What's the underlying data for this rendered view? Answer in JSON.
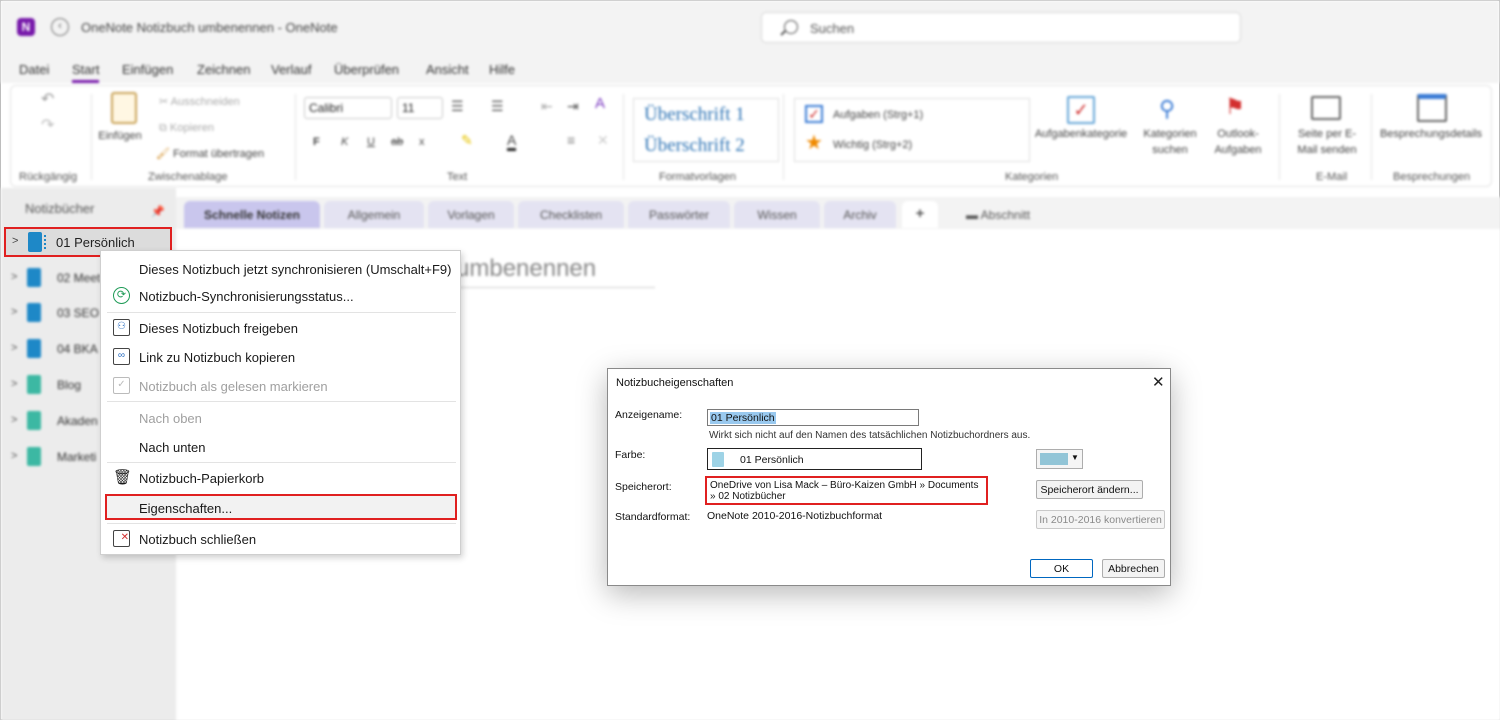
{
  "window": {
    "title": "OneNote Notizbuch umbenennen - OneNote",
    "search_placeholder": "Suchen"
  },
  "menu": [
    "Datei",
    "Start",
    "Einfügen",
    "Zeichnen",
    "Verlauf",
    "Überprüfen",
    "Ansicht",
    "Hilfe"
  ],
  "ribbon": {
    "undo_group": "Rückgängig",
    "clipboard": {
      "paste": "Einfügen",
      "cut": "Ausschneiden",
      "copy": "Kopieren",
      "format": "Format übertragen",
      "group": "Zwischenablage"
    },
    "text": {
      "font": "Calibri",
      "size": "11",
      "bold": "F",
      "italic": "K",
      "underline": "U",
      "strike": "ab",
      "sub": "x",
      "group": "Text"
    },
    "styles": {
      "h1": "Überschrift 1",
      "h2": "Überschrift 2",
      "group": "Formatvorlagen"
    },
    "tags": {
      "todo": "Aufgaben (Strg+1)",
      "important": "Wichtig (Strg+2)",
      "tag_category": "Aufgabenkategorie",
      "find_tags": "Kategorien suchen",
      "outlook_tasks": "Outlook-Aufgaben",
      "group": "Kategorien"
    },
    "email": {
      "send": "Seite per E-Mail senden",
      "group": "E-Mail"
    },
    "meetings": {
      "details": "Besprechungsdetails",
      "group": "Besprechungen"
    }
  },
  "notebooks": {
    "header": "Notizbücher",
    "items": [
      {
        "label": "01 Persönlich",
        "color": "#1e88c7"
      },
      {
        "label": "02 Meet",
        "color": "#1e88c7"
      },
      {
        "label": "03 SEO",
        "color": "#1e88c7"
      },
      {
        "label": "04 BKA",
        "color": "#1e88c7"
      },
      {
        "label": "Blog",
        "color": "#3cb8a3"
      },
      {
        "label": "Akaden",
        "color": "#3cb8a3"
      },
      {
        "label": "Marketi",
        "color": "#3cb8a3"
      }
    ]
  },
  "sections": [
    "Schnelle Notizen",
    "Allgemein",
    "Vorlagen",
    "Checklisten",
    "Passwörter",
    "Wissen",
    "Archiv",
    "+",
    "Abschnitt"
  ],
  "page": {
    "title": "umbenennen"
  },
  "context_menu": {
    "items": [
      {
        "label": "Dieses Notizbuch jetzt synchronisieren  (Umschalt+F9)",
        "icon": ""
      },
      {
        "label": "Notizbuch-Synchronisierungsstatus...",
        "icon": "sync-icon"
      },
      {
        "label": "Dieses Notizbuch freigeben",
        "icon": "share-icon"
      },
      {
        "label": "Link zu Notizbuch kopieren",
        "icon": "link-icon"
      },
      {
        "label": "Notizbuch als gelesen markieren",
        "icon": "mark-read-icon"
      },
      {
        "label": "Nach oben",
        "icon": ""
      },
      {
        "label": "Nach unten",
        "icon": ""
      },
      {
        "label": "Notizbuch-Papierkorb",
        "icon": "trash-icon"
      },
      {
        "label": "Eigenschaften...",
        "icon": ""
      },
      {
        "label": "Notizbuch schließen",
        "icon": "close-notebook-icon"
      }
    ]
  },
  "dialog": {
    "title": "Notizbucheigenschaften",
    "display_name_label": "Anzeigename:",
    "display_name_value": "01 Persönlich",
    "display_name_hint": "Wirkt sich nicht auf den Namen des tatsächlichen Notizbuchordners aus.",
    "color_label": "Farbe:",
    "color_preview_text": "01 Persönlich",
    "color_value": "#92c5d7",
    "location_label": "Speicherort:",
    "location_value": "OneDrive von Lisa Mack – Büro-Kaizen GmbH » Documents » 02 Notizbücher",
    "change_location_button": "Speicherort ändern...",
    "format_label": "Standardformat:",
    "format_value": "OneNote 2010-2016-Notizbuchformat",
    "convert_button": "In 2010-2016 konvertieren",
    "ok_button": "OK",
    "cancel_button": "Abbrechen"
  }
}
